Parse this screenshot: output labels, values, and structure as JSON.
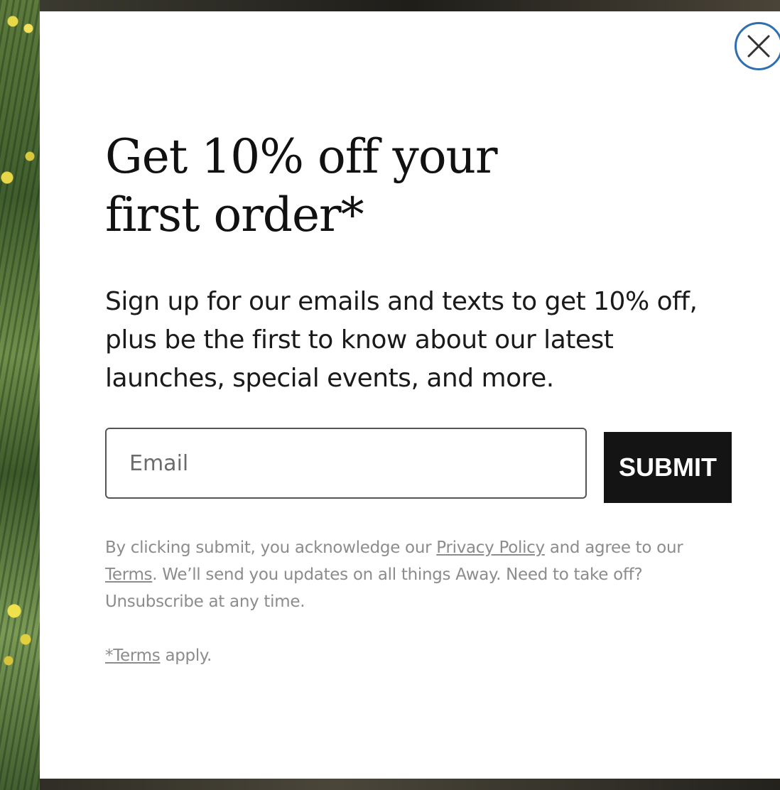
{
  "modal": {
    "headline_line1": "Get 10% off your",
    "headline_line2": "first order*",
    "description_line1": "Sign up for our emails and texts to get 10% off,",
    "description_line2": "plus be the first to know about our latest",
    "description_line3": "launches, special events, and more.",
    "close_icon": "close-icon"
  },
  "form": {
    "email_placeholder": "Email",
    "email_value": "",
    "submit_label": "SUBMIT"
  },
  "legal": {
    "part1": "By clicking submit, you acknowledge our ",
    "privacy_link": "Privacy Policy",
    "part2": " and agree to our",
    "terms_link": "Terms",
    "part3": ". We’ll send you updates on all things Away. Need to take off?",
    "part4": "Unsubscribe at any time."
  },
  "terms_note": {
    "link": "*Terms",
    "suffix": " apply."
  },
  "colors": {
    "close_ring": "#2f6fb0",
    "submit_bg": "#141414",
    "legal_text": "#8c8c8c"
  }
}
